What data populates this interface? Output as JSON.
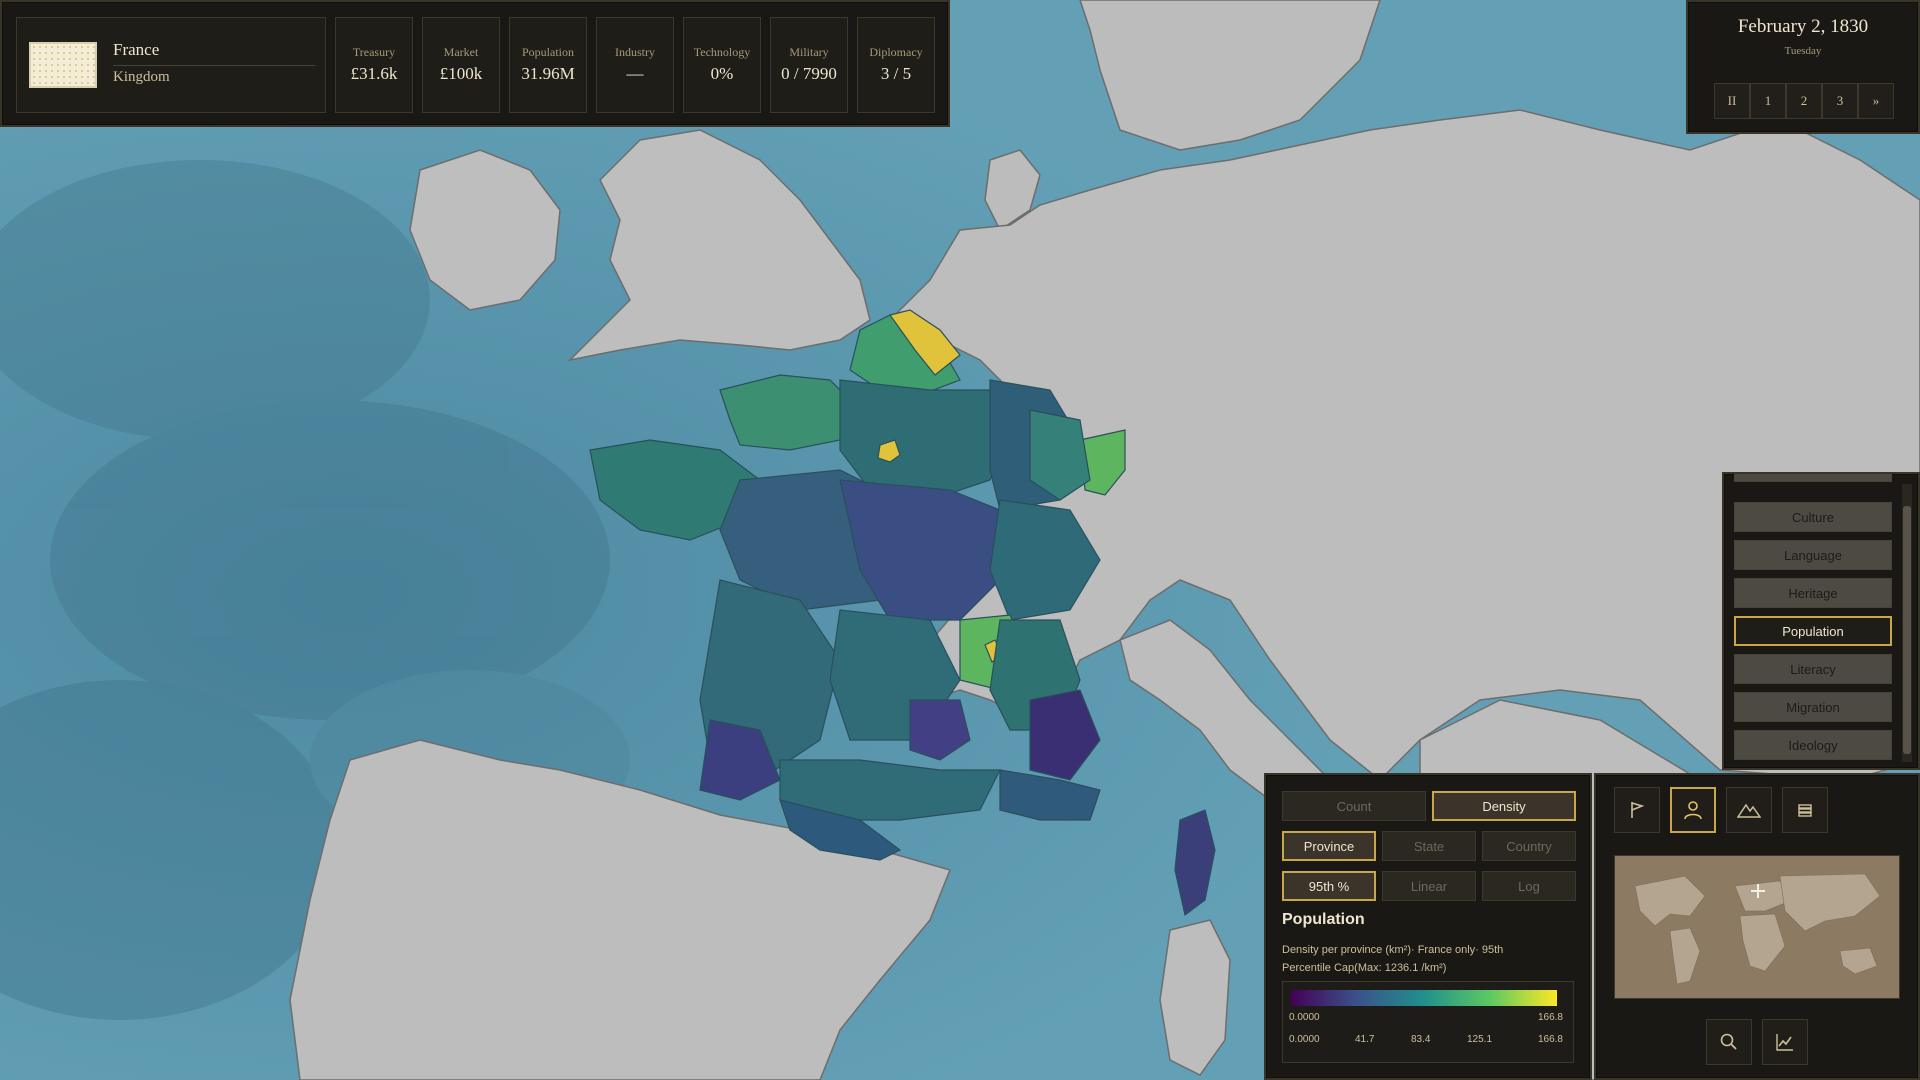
{
  "nation": {
    "name": "France",
    "government": "Kingdom",
    "flag_icon": "france-royal-flag"
  },
  "stats": [
    {
      "label": "Treasury",
      "value": "£31.6k"
    },
    {
      "label": "Market",
      "value": "£100k"
    },
    {
      "label": "Population",
      "value": "31.96M"
    },
    {
      "label": "Industry",
      "value": "—"
    },
    {
      "label": "Technology",
      "value": "0%"
    },
    {
      "label": "Military",
      "value": "0 / 7990"
    },
    {
      "label": "Diplomacy",
      "value": "3 / 5"
    }
  ],
  "date": {
    "main": "February 2, 1830",
    "weekday": "Tuesday"
  },
  "speed": {
    "buttons": [
      "II",
      "1",
      "2",
      "3",
      "»"
    ]
  },
  "mapmodes": {
    "items": [
      "Culture",
      "Language",
      "Heritage",
      "Population",
      "Literacy",
      "Migration",
      "Ideology"
    ],
    "active": "Population"
  },
  "population_panel": {
    "metric": {
      "count": "Count",
      "density": "Density",
      "active": "Density"
    },
    "scope": {
      "province": "Province",
      "state": "State",
      "country": "Country",
      "active": "Province"
    },
    "scale": {
      "p95": "95th %",
      "linear": "Linear",
      "log": "Log",
      "active": "95th %"
    },
    "title": "Population",
    "description": "Density per province (km²)· France only· 95th Percentile Cap(Max: 1236.1 /km²)",
    "legend": {
      "min": "0.0000",
      "max": "166.8",
      "ticks": [
        "0.0000",
        "41.7",
        "83.4",
        "125.1",
        "166.8"
      ],
      "colors": [
        "#440154",
        "#3b528b",
        "#21908d",
        "#5dc963",
        "#fde725"
      ]
    }
  },
  "tools": {
    "top": [
      "flag-icon",
      "person-icon",
      "mountains-icon",
      "stack-icon"
    ],
    "active": "person-icon",
    "bottom": [
      "search-icon",
      "chart-icon"
    ]
  },
  "colors": {
    "sea": "#5f99ad",
    "land": "#b9b9b9",
    "accent_gold": "#c9a64a",
    "panel_bg": "#1a1814"
  }
}
